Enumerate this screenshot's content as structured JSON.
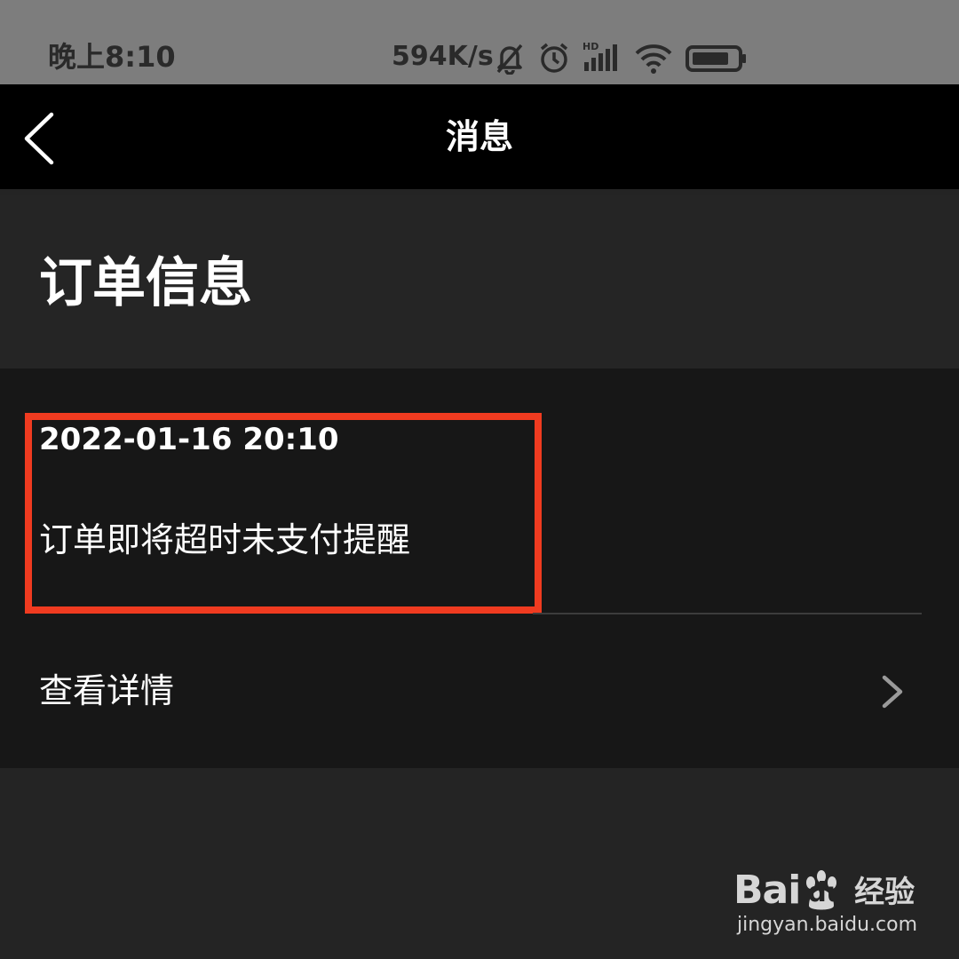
{
  "status_bar": {
    "time": "晚上8:10",
    "network_speed": "594K/s",
    "icons": [
      "bell-muted-icon",
      "alarm-icon",
      "hd-signal-icon",
      "wifi-icon",
      "battery-icon"
    ],
    "hd_label": "HD"
  },
  "nav": {
    "title": "消息",
    "back_icon": "chevron-left-icon"
  },
  "section": {
    "title": "订单信息"
  },
  "message": {
    "timestamp": "2022-01-16 20:10",
    "text": "订单即将超时未支付提醒",
    "detail_label": "查看详情",
    "detail_icon": "chevron-right-icon"
  },
  "watermark": {
    "brand": "Bai",
    "brand_du": "du",
    "brand_cn": "经验",
    "url": "jingyan.baidu.com"
  },
  "colors": {
    "highlight": "#f03b20",
    "nav_bg": "#000000",
    "status_bg": "#7d7d7d",
    "card_bg": "#171717"
  }
}
